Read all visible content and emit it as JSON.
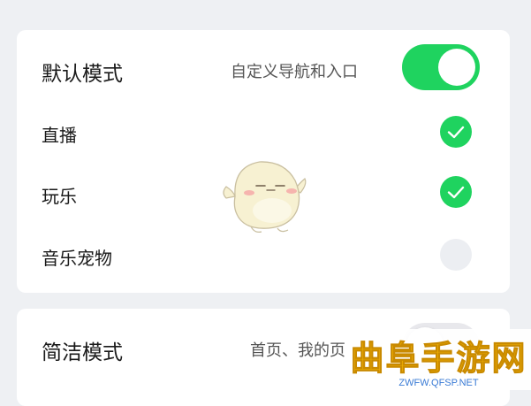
{
  "default_mode": {
    "title": "默认模式",
    "description": "自定义导航和入口",
    "toggle_on": true,
    "items": [
      {
        "label": "直播",
        "checked": true
      },
      {
        "label": "玩乐",
        "checked": true
      },
      {
        "label": "音乐宠物",
        "checked": false
      }
    ]
  },
  "simple_mode": {
    "title": "简洁模式",
    "description": "首页、我的页",
    "toggle_on": false
  },
  "mascot": {
    "icon": "mascot-character-icon"
  },
  "watermark": {
    "brand": "曲阜手游网",
    "url": "ZWFW.QFSP.NET"
  },
  "colors": {
    "accent": "#1fd35f",
    "background": "#eef0f3",
    "card": "#ffffff",
    "watermark_text": "#f2b200"
  }
}
